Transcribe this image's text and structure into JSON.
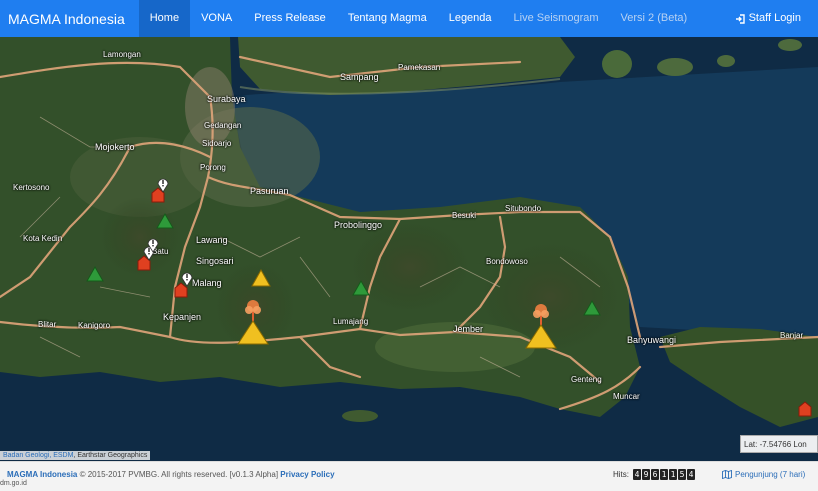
{
  "nav": {
    "brand": "MAGMA Indonesia",
    "items": [
      {
        "label": "Home",
        "state": "active"
      },
      {
        "label": "VONA",
        "state": "normal"
      },
      {
        "label": "Press Release",
        "state": "normal"
      },
      {
        "label": "Tentang Magma",
        "state": "normal"
      },
      {
        "label": "Legenda",
        "state": "normal"
      },
      {
        "label": "Live Seismogram",
        "state": "dim"
      },
      {
        "label": "Versi 2 (Beta)",
        "state": "dim"
      }
    ],
    "staff_login": "Staff Login",
    "staff_icon": "sign-in-icon",
    "color": "#1f7ef0"
  },
  "map": {
    "places": [
      "Lamongan",
      "Surabaya",
      "Gedangan",
      "Sidoarjo",
      "Porong",
      "Mojokerto",
      "Kertosono",
      "Kota Kedin",
      "Pasuruan",
      "Lawang",
      "Batu",
      "Singosari",
      "Malang",
      "Kepanjen",
      "Blitar",
      "Kanigoro",
      "Sampang",
      "Pamekasan",
      "Probolinggo",
      "Besuki",
      "Situbondo",
      "Bondowoso",
      "Lumajang",
      "Jember",
      "Banyuwangi",
      "Genteng",
      "Muncar",
      "Banjar"
    ],
    "attribution": {
      "link": "Badan Geologi, ESDM",
      "rest": ", Earthstar Geographics"
    },
    "latlon_text": "Lat: -7.54766 Lon"
  },
  "footer": {
    "brand": "MAGMA Indonesia",
    "copyright": " © 2015-2017 PVMBG. All rights reserved. [v0.1.3 Alpha] ",
    "privacy": "Privacy Policy",
    "hits_label": "Hits:",
    "hits_digits": [
      "4",
      "9",
      "6",
      "1",
      "1",
      "5",
      "4"
    ],
    "pengunjung": "Pengunjung (7 hari)",
    "url": "dm.go.id"
  }
}
